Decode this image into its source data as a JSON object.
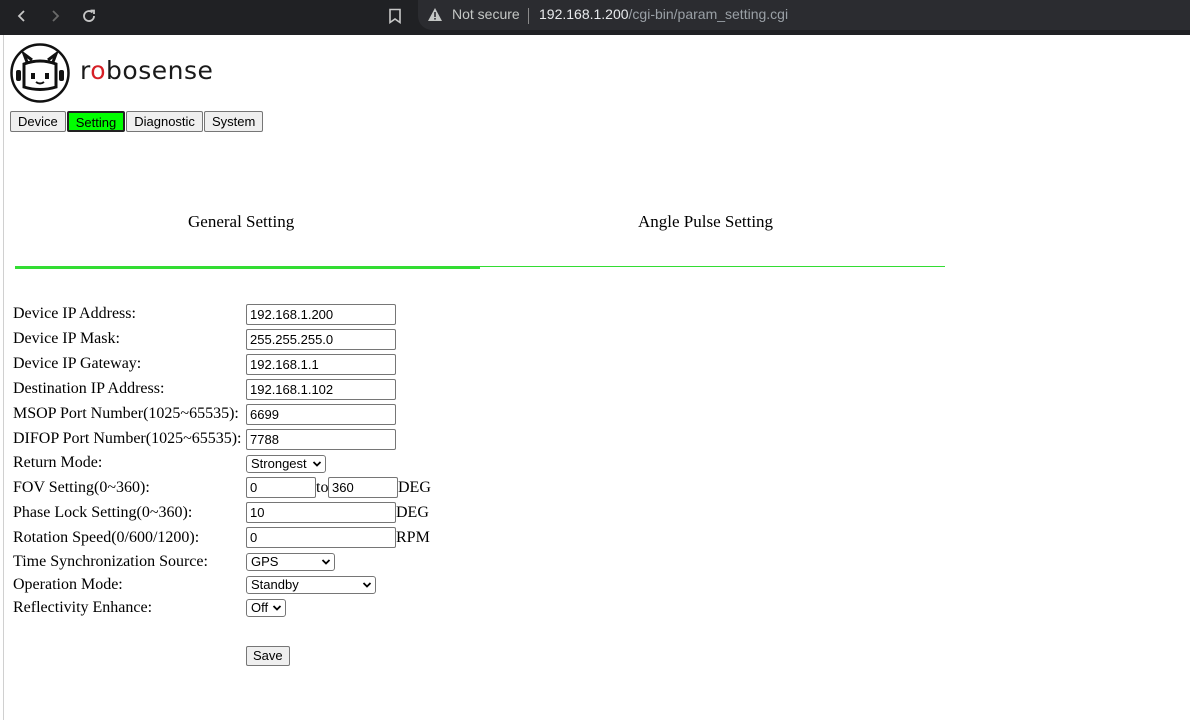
{
  "browser": {
    "security_label": "Not secure",
    "url_host": "192.168.1.200",
    "url_path": "/cgi-bin/param_setting.cgi"
  },
  "brand": {
    "pre": "r",
    "o": "o",
    "post": "bosense",
    "accent_color": "#d61f26"
  },
  "tabs": [
    {
      "label": "Device",
      "active": false
    },
    {
      "label": "Setting",
      "active": true
    },
    {
      "label": "Diagnostic",
      "active": false
    },
    {
      "label": "System",
      "active": false
    }
  ],
  "sub_tabs": {
    "general": "General Setting",
    "angle_pulse": "Angle Pulse Setting"
  },
  "form": {
    "ip_address_label": "Device IP Address:",
    "ip_address_value": "192.168.1.200",
    "ip_mask_label": "Device IP Mask:",
    "ip_mask_value": "255.255.255.0",
    "ip_gateway_label": "Device IP Gateway:",
    "ip_gateway_value": "192.168.1.1",
    "dest_ip_label": "Destination IP Address:",
    "dest_ip_value": "192.168.1.102",
    "msop_label": "MSOP Port Number(1025~65535):",
    "msop_value": "6699",
    "difop_label": "DIFOP Port Number(1025~65535):",
    "difop_value": "7788",
    "return_mode_label": "Return Mode:",
    "return_mode_value": "Strongest",
    "fov_label": "FOV Setting(0~360):",
    "fov_start": "0",
    "fov_to": "to",
    "fov_end": "360",
    "fov_unit": "DEG",
    "phase_lock_label": "Phase Lock Setting(0~360):",
    "phase_lock_value": "10",
    "phase_lock_unit": "DEG",
    "rotation_label": "Rotation Speed(0/600/1200):",
    "rotation_value": "0",
    "rotation_unit": "RPM",
    "time_sync_label": "Time Synchronization Source:",
    "time_sync_value": "GPS",
    "operation_label": "Operation Mode:",
    "operation_value": "Standby",
    "reflectivity_label": "Reflectivity Enhance:",
    "reflectivity_value": "Off",
    "save_label": "Save"
  },
  "colors": {
    "active_tab": "#00ff00",
    "divider": "#33dd33"
  }
}
